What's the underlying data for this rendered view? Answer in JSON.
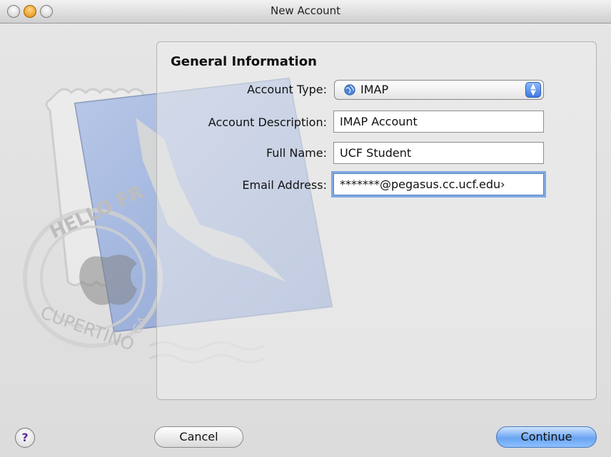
{
  "window": {
    "title": "New Account"
  },
  "panel": {
    "section_title": "General Information",
    "account_type": {
      "label": "Account Type:",
      "value": "IMAP"
    },
    "account_description": {
      "label": "Account Description:",
      "value": "IMAP Account"
    },
    "full_name": {
      "label": "Full Name:",
      "value": "UCF Student"
    },
    "email_address": {
      "label": "Email Address:",
      "value": "*******@pegasus.cc.ucf.edu›"
    }
  },
  "buttons": {
    "help": "?",
    "cancel": "Cancel",
    "continue": "Continue"
  },
  "artwork": {
    "stamp_text_top": "HELLO FR",
    "stamp_text_bottom": "CUPERTINO",
    "stamp_text_side": "CA"
  },
  "colors": {
    "accent": "#6aa4f2",
    "focus_ring": "#7fa9e0"
  }
}
